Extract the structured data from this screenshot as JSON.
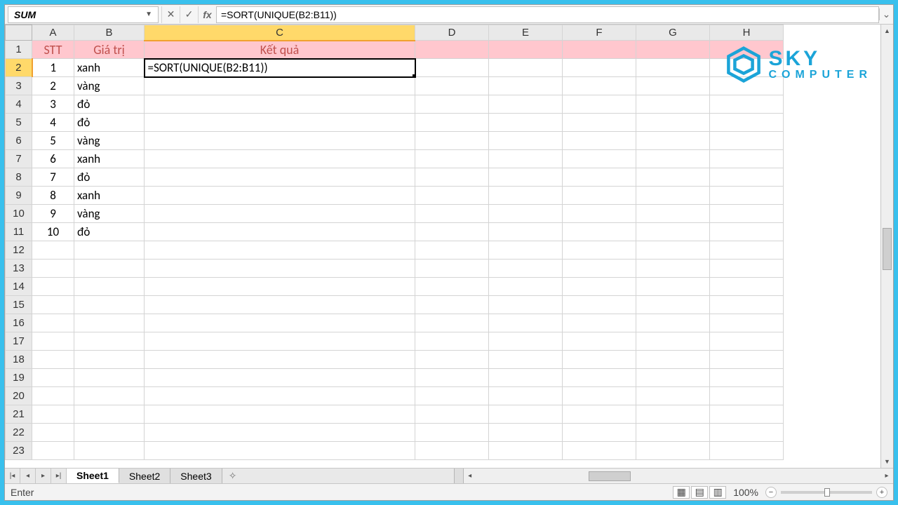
{
  "namebox": {
    "value": "SUM"
  },
  "formula_bar": {
    "value": "=SORT(UNIQUE(B2:B11))"
  },
  "cols": [
    "A",
    "B",
    "C",
    "D",
    "E",
    "F",
    "G",
    "H"
  ],
  "rows_visible": 23,
  "active_col_idx": 2,
  "active_row_idx": 1,
  "headers": {
    "A": "STT",
    "B": "Giá trị",
    "C": "Kết quả"
  },
  "data": [
    {
      "a": "1",
      "b": "xanh"
    },
    {
      "a": "2",
      "b": "vàng"
    },
    {
      "a": "3",
      "b": "đỏ"
    },
    {
      "a": "4",
      "b": "đỏ"
    },
    {
      "a": "5",
      "b": "vàng"
    },
    {
      "a": "6",
      "b": "xanh"
    },
    {
      "a": "7",
      "b": "đỏ"
    },
    {
      "a": "8",
      "b": "xanh"
    },
    {
      "a": "9",
      "b": "vàng"
    },
    {
      "a": "10",
      "b": "đỏ"
    }
  ],
  "editing_cell_value": "=SORT(UNIQUE(B2:B11))",
  "sheet_tabs": [
    "Sheet1",
    "Sheet2",
    "Sheet3"
  ],
  "active_tab": 0,
  "status": {
    "mode": "Enter",
    "zoom": "100%"
  },
  "watermark": {
    "line1": "SKY",
    "line2": "COMPUTER"
  }
}
